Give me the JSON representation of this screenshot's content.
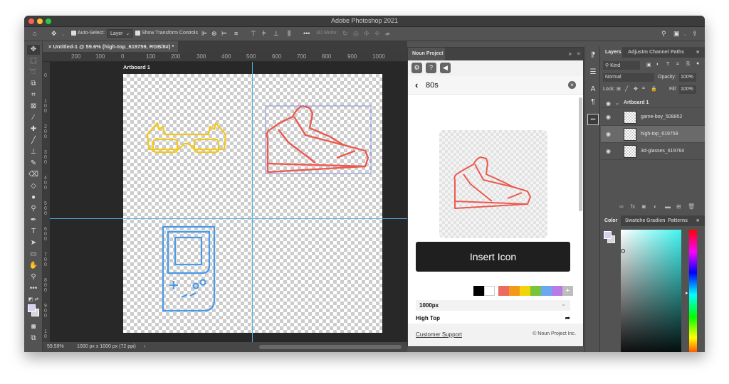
{
  "app": {
    "title": "Adobe Photoshop 2021",
    "traffic_lights": [
      "#fe5f57",
      "#febc2e",
      "#28c840"
    ]
  },
  "options_bar": {
    "auto_select_label": "Auto-Select:",
    "auto_select_value": "Layer",
    "show_transform_label": "Show Transform Controls",
    "mode_3d_label": "3D Mode:"
  },
  "document": {
    "tab_label": "Untitled-1 @ 59.6% (high-top_619759, RGB/8#) *",
    "artboard_label": "Artboard 1",
    "ruler_h": [
      "200",
      "100",
      "0",
      "100",
      "200",
      "300",
      "400",
      "500",
      "600",
      "700",
      "800",
      "900",
      "1000"
    ],
    "ruler_v": [
      "0",
      "100",
      "200",
      "300",
      "400",
      "500",
      "600",
      "700",
      "800",
      "900",
      "10"
    ],
    "zoom": "59.59%",
    "doc_info": "1000 px x 1000 px (72 ppi)",
    "status_arrow": "›"
  },
  "canvas_icons": [
    {
      "name": "3d-glasses",
      "color": "#f2c81c"
    },
    {
      "name": "high-top",
      "color": "#ec5a50"
    },
    {
      "name": "game-boy",
      "color": "#4a9ae8"
    }
  ],
  "noun_project": {
    "tab": "Noun Project",
    "search_term": "80s",
    "insert_label": "Insert Icon",
    "size_value": "1000px",
    "icon_name": "High Top",
    "support_link": "Customer Support",
    "copyright": "© Noun Project Inc.",
    "swatches_mono": [
      "#000000",
      "#ffffff"
    ],
    "swatches_color": [
      "#ec6a62",
      "#f29a18",
      "#f2d40c",
      "#78c43a",
      "#6aa8f0",
      "#b77ae6"
    ],
    "add_swatch_label": "+"
  },
  "layers_panel": {
    "tabs": [
      "Layers",
      "Adjustm",
      "Channel",
      "Paths"
    ],
    "filter_kind": "Kind",
    "blend_mode": "Normal",
    "opacity_label": "Opacity:",
    "opacity_value": "100%",
    "lock_label": "Lock:",
    "fill_label": "Fill:",
    "fill_value": "100%",
    "group": "Artboard 1",
    "layers": [
      {
        "name": "game-boy_508852",
        "selected": false
      },
      {
        "name": "high-top_619759",
        "selected": true
      },
      {
        "name": "3d-glasses_619764",
        "selected": false
      }
    ]
  },
  "color_panel": {
    "tabs": [
      "Color",
      "Swatche",
      "Gradien",
      "Patterns"
    ],
    "foreground": "#d8cff5",
    "background": "#d6d6d6",
    "hue_base": "#3ff5f0"
  }
}
